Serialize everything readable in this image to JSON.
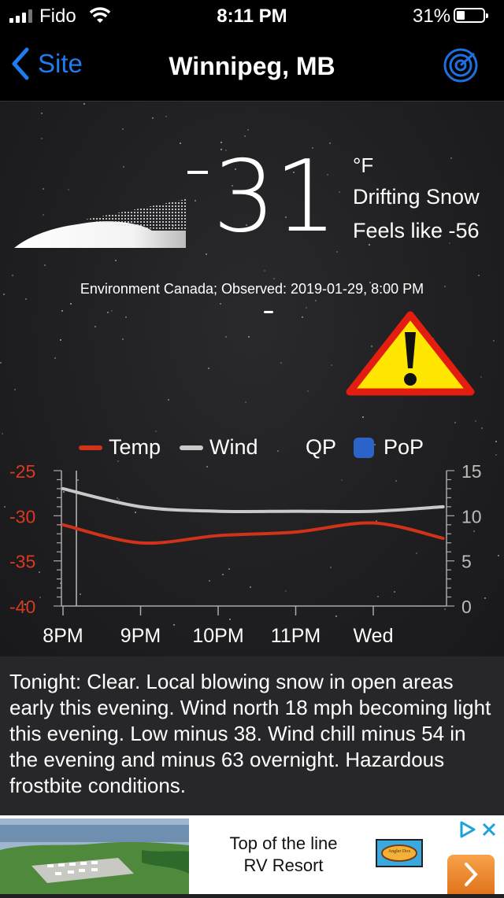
{
  "status_bar": {
    "carrier": "Fido",
    "time": "8:11 PM",
    "battery": "31%",
    "battery_level": 0.31
  },
  "nav": {
    "back_label": "Site",
    "title": "Winnipeg, MB",
    "radar_icon": "radar-icon"
  },
  "current": {
    "temperature": "31",
    "unit": "°F",
    "condition": "Drifting Snow",
    "feels_like": "Feels like -56",
    "observed": "Environment Canada; Observed: 2019-01-29, 8:00 PM",
    "warning_icon": "warning-icon",
    "colors": {
      "warning_fill": "#ffe600",
      "warning_border": "#e31e10"
    }
  },
  "chart_data": {
    "type": "line",
    "legend": [
      "Temp",
      "Wind",
      "QP",
      "PoP"
    ],
    "x_labels": [
      "8PM",
      "9PM",
      "10PM",
      "11PM",
      "Wed"
    ],
    "left_axis": {
      "ticks": [
        "-25",
        "-30",
        "-35",
        "-40"
      ],
      "ylim": [
        -40,
        -25
      ],
      "color": "#d93a1f"
    },
    "right_axis": {
      "ticks": [
        "15",
        "10",
        "5",
        "0"
      ],
      "ylim": [
        0,
        15
      ],
      "color": "#bbbbbb"
    },
    "series": [
      {
        "name": "Temp",
        "axis": "left",
        "color": "#d0321a",
        "values": [
          -31,
          -33,
          -32.2,
          -31.8,
          -30.8,
          -32.5
        ]
      },
      {
        "name": "Wind",
        "axis": "right",
        "color": "#c9c9c9",
        "values": [
          13,
          11,
          10.5,
          10.5,
          10.5,
          11
        ]
      }
    ],
    "x_positions": [
      0,
      1,
      2,
      3,
      4,
      4.9
    ]
  },
  "forecast": {
    "text": "Tonight:  Clear. Local blowing snow in open areas early this evening. Wind north 18 mph becoming light this evening. Low minus 38. Wind chill minus 54 in the evening and minus 63 overnight. Hazardous frostbite conditions."
  },
  "ad": {
    "line1": "Top of the line",
    "line2": "RV Resort",
    "logo_text": "Angler Dox"
  }
}
